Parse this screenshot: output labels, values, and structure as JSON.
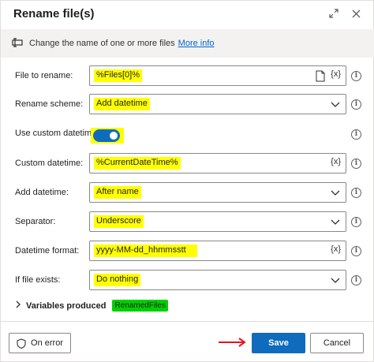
{
  "dialog": {
    "title": "Rename file(s)",
    "info_text": "Change the name of one or more files",
    "more_info": "More info"
  },
  "fields": {
    "file_to_rename": {
      "label": "File to rename:",
      "value": "%Files[0]%",
      "var_tag": "{x}"
    },
    "rename_scheme": {
      "label": "Rename scheme:",
      "value": "Add datetime"
    },
    "use_custom_datetime": {
      "label": "Use custom datetime:",
      "enabled": true
    },
    "custom_datetime": {
      "label": "Custom datetime:",
      "value": "%CurrentDateTime%",
      "var_tag": "{x}"
    },
    "add_datetime": {
      "label": "Add datetime:",
      "value": "After name"
    },
    "separator": {
      "label": "Separator:",
      "value": "Underscore"
    },
    "datetime_format": {
      "label": "Datetime format:",
      "value": "yyyy-MM-dd_hhmmsstt",
      "var_tag": "{x}"
    },
    "if_file_exists": {
      "label": "If file exists:",
      "value": "Do nothing"
    }
  },
  "variables": {
    "label": "Variables produced",
    "items": [
      "RenamedFiles"
    ]
  },
  "footer": {
    "on_error": "On error",
    "save": "Save",
    "cancel": "Cancel"
  },
  "info_glyph": "i",
  "colors": {
    "highlight": "#ffff00",
    "variable_highlight": "#00d000",
    "accent": "#0f6cbd",
    "arrow": "#e81123"
  }
}
